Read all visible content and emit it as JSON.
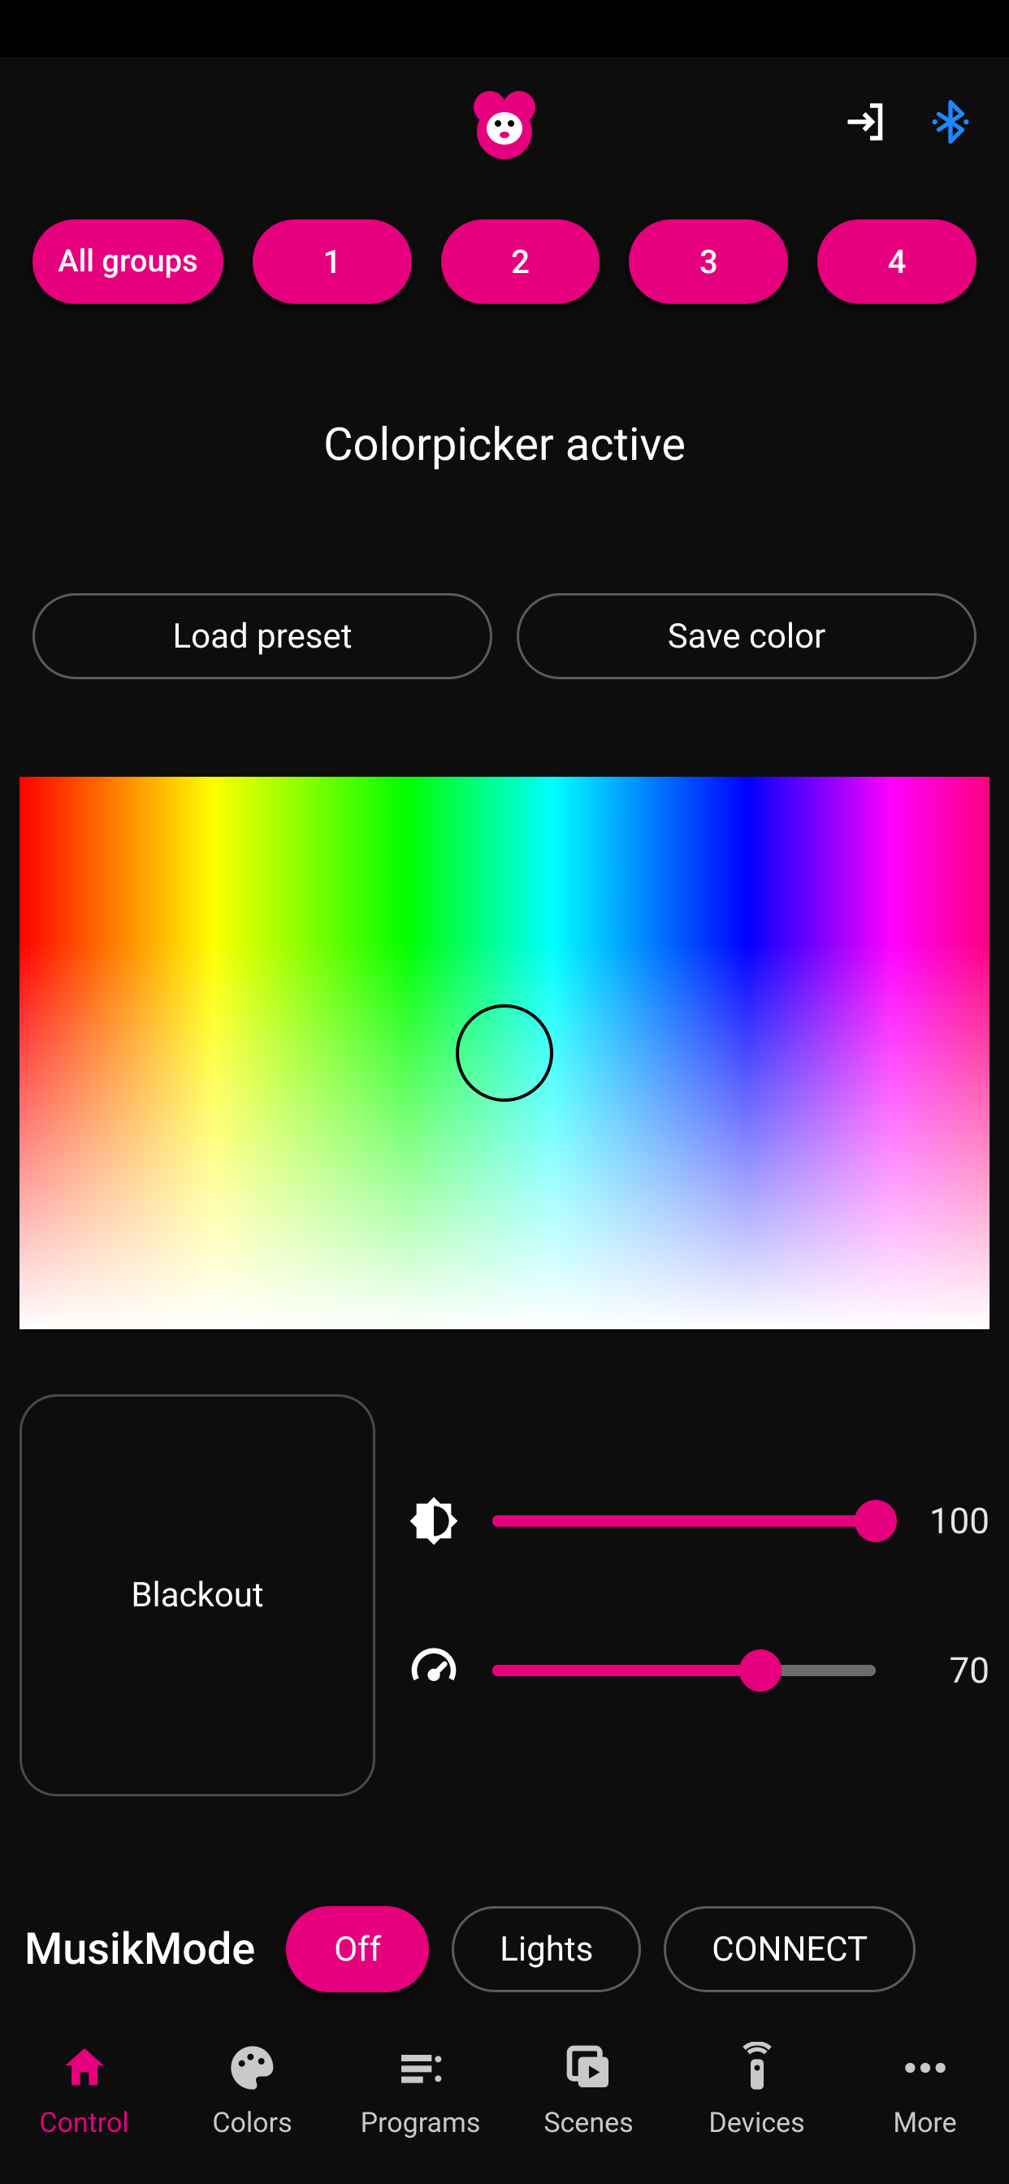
{
  "colors": {
    "accent": "#e6007e",
    "bluetooth": "#1e88ff"
  },
  "groups": {
    "all_label": "All groups",
    "items": [
      "1",
      "2",
      "3",
      "4"
    ]
  },
  "status_title": "Colorpicker active",
  "presets": {
    "load_label": "Load preset",
    "save_label": "Save color"
  },
  "blackout_label": "Blackout",
  "sliders": {
    "brightness": {
      "value": 100,
      "percent": 100
    },
    "speed": {
      "value": 70,
      "percent": 70
    }
  },
  "musik": {
    "label": "MusikMode",
    "options": [
      {
        "label": "Off",
        "active": true
      },
      {
        "label": "Lights",
        "active": false
      },
      {
        "label": "CONNECT",
        "active": false
      }
    ]
  },
  "nav": [
    {
      "label": "Control",
      "active": true
    },
    {
      "label": "Colors",
      "active": false
    },
    {
      "label": "Programs",
      "active": false
    },
    {
      "label": "Scenes",
      "active": false
    },
    {
      "label": "Devices",
      "active": false
    },
    {
      "label": "More",
      "active": false
    }
  ]
}
